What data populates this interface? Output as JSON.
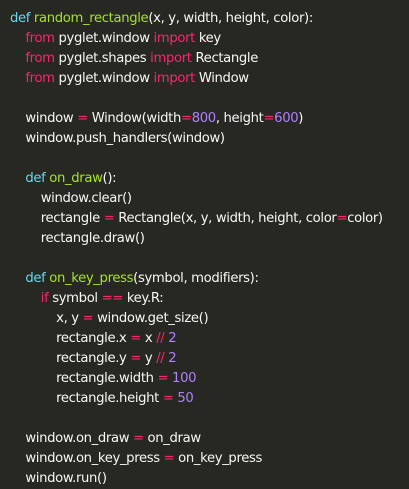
{
  "theme": {
    "background": "#272822",
    "foreground": "#f8f8f2",
    "keyword": "#f92672",
    "declaration": "#66d9ef",
    "function_name": "#a6e22e",
    "number": "#ae81ff"
  },
  "code": {
    "lines": [
      [
        [
          "decl",
          "def"
        ],
        [
          "ws",
          " "
        ],
        [
          "func",
          "random_rectangle"
        ],
        [
          "punct",
          "(x, y, width, height, color):"
        ]
      ],
      [
        [
          "ws",
          "    "
        ],
        [
          "keyword",
          "from"
        ],
        [
          "ident",
          " pyglet.window "
        ],
        [
          "keyword",
          "import"
        ],
        [
          "ident",
          " key"
        ]
      ],
      [
        [
          "ws",
          "    "
        ],
        [
          "keyword",
          "from"
        ],
        [
          "ident",
          " pyglet.shapes "
        ],
        [
          "keyword",
          "import"
        ],
        [
          "ident",
          " Rectangle"
        ]
      ],
      [
        [
          "ws",
          "    "
        ],
        [
          "keyword",
          "from"
        ],
        [
          "ident",
          " pyglet.window "
        ],
        [
          "keyword",
          "import"
        ],
        [
          "ident",
          " Window"
        ]
      ],
      [],
      [
        [
          "ws",
          "    "
        ],
        [
          "ident",
          "window "
        ],
        [
          "op",
          "="
        ],
        [
          "ident",
          " Window(width"
        ],
        [
          "op",
          "="
        ],
        [
          "number",
          "800"
        ],
        [
          "ident",
          ", height"
        ],
        [
          "op",
          "="
        ],
        [
          "number",
          "600"
        ],
        [
          "punct",
          ")"
        ]
      ],
      [
        [
          "ws",
          "    "
        ],
        [
          "ident",
          "window.push_handlers(window)"
        ]
      ],
      [],
      [
        [
          "ws",
          "    "
        ],
        [
          "decl",
          "def"
        ],
        [
          "ws",
          " "
        ],
        [
          "func",
          "on_draw"
        ],
        [
          "punct",
          "():"
        ]
      ],
      [
        [
          "ws",
          "        "
        ],
        [
          "ident",
          "window.clear()"
        ]
      ],
      [
        [
          "ws",
          "        "
        ],
        [
          "ident",
          "rectangle "
        ],
        [
          "op",
          "="
        ],
        [
          "ident",
          " Rectangle(x, y, width, height, color"
        ],
        [
          "op",
          "="
        ],
        [
          "ident",
          "color)"
        ]
      ],
      [
        [
          "ws",
          "        "
        ],
        [
          "ident",
          "rectangle.draw()"
        ]
      ],
      [],
      [
        [
          "ws",
          "    "
        ],
        [
          "decl",
          "def"
        ],
        [
          "ws",
          " "
        ],
        [
          "func",
          "on_key_press"
        ],
        [
          "punct",
          "(symbol, modifiers):"
        ]
      ],
      [
        [
          "ws",
          "        "
        ],
        [
          "keyword",
          "if"
        ],
        [
          "ident",
          " symbol "
        ],
        [
          "op",
          "=="
        ],
        [
          "ident",
          " key.R:"
        ]
      ],
      [
        [
          "ws",
          "            "
        ],
        [
          "ident",
          "x, y "
        ],
        [
          "op",
          "="
        ],
        [
          "ident",
          " window.get_size()"
        ]
      ],
      [
        [
          "ws",
          "            "
        ],
        [
          "ident",
          "rectangle.x "
        ],
        [
          "op",
          "="
        ],
        [
          "ident",
          " x "
        ],
        [
          "op",
          "//"
        ],
        [
          "ws",
          " "
        ],
        [
          "number",
          "2"
        ]
      ],
      [
        [
          "ws",
          "            "
        ],
        [
          "ident",
          "rectangle.y "
        ],
        [
          "op",
          "="
        ],
        [
          "ident",
          " y "
        ],
        [
          "op",
          "//"
        ],
        [
          "ws",
          " "
        ],
        [
          "number",
          "2"
        ]
      ],
      [
        [
          "ws",
          "            "
        ],
        [
          "ident",
          "rectangle.width "
        ],
        [
          "op",
          "="
        ],
        [
          "ws",
          " "
        ],
        [
          "number",
          "100"
        ]
      ],
      [
        [
          "ws",
          "            "
        ],
        [
          "ident",
          "rectangle.height "
        ],
        [
          "op",
          "="
        ],
        [
          "ws",
          " "
        ],
        [
          "number",
          "50"
        ]
      ],
      [],
      [
        [
          "ws",
          "    "
        ],
        [
          "ident",
          "window.on_draw "
        ],
        [
          "op",
          "="
        ],
        [
          "ident",
          " on_draw"
        ]
      ],
      [
        [
          "ws",
          "    "
        ],
        [
          "ident",
          "window.on_key_press "
        ],
        [
          "op",
          "="
        ],
        [
          "ident",
          " on_key_press"
        ]
      ],
      [
        [
          "ws",
          "    "
        ],
        [
          "ident",
          "window.run()"
        ]
      ]
    ]
  }
}
